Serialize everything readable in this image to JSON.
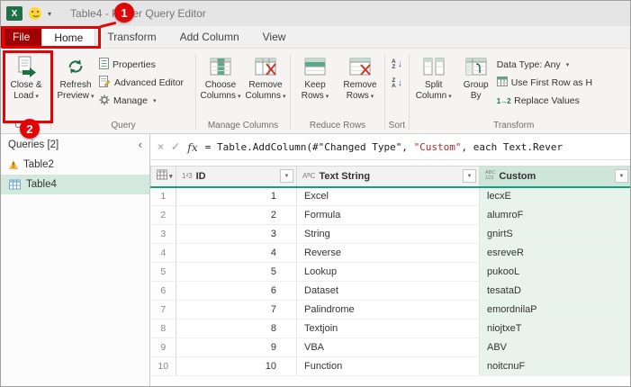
{
  "window": {
    "title": "Table4 - Power Query Editor"
  },
  "annotations": {
    "badge1": "1",
    "badge2": "2"
  },
  "icons": {
    "excel": "X",
    "dropdown_caret": "▾",
    "filter": "▼",
    "collapse": "‹",
    "cancel": "×",
    "commit": "✓",
    "sort_arrow": "↓",
    "replace_values": "1→2"
  },
  "tabs": {
    "file": "File",
    "home": "Home",
    "transform": "Transform",
    "add_column": "Add Column",
    "view": "View"
  },
  "ribbon": {
    "close_load": {
      "line1": "Close &",
      "line2": "Load"
    },
    "close_group_label": "Close",
    "refresh": {
      "line1": "Refresh",
      "line2": "Preview"
    },
    "properties": "Properties",
    "advanced_editor": "Advanced Editor",
    "manage": "Manage",
    "query_group_label": "Query",
    "choose_columns": {
      "line1": "Choose",
      "line2": "Columns"
    },
    "remove_columns": {
      "line1": "Remove",
      "line2": "Columns"
    },
    "manage_columns_group_label": "Manage Columns",
    "keep_rows": {
      "line1": "Keep",
      "line2": "Rows"
    },
    "remove_rows": {
      "line1": "Remove",
      "line2": "Rows"
    },
    "reduce_rows_group_label": "Reduce Rows",
    "sort_az": {
      "top": "A",
      "bottom": "Z"
    },
    "sort_za": {
      "top": "Z",
      "bottom": "A"
    },
    "sort_group_label": "Sort",
    "split_column": {
      "line1": "Split",
      "line2": "Column"
    },
    "group_by": {
      "line1": "Group",
      "line2": "By"
    },
    "data_type_label": "Data Type: Any",
    "use_first_row_label": "Use First Row as H",
    "replace_values_label": "Replace Values",
    "transform_group_label": "Transform"
  },
  "queries_panel": {
    "header": "Queries [2]",
    "items": [
      {
        "name": "Table2",
        "icon": "warning",
        "selected": false
      },
      {
        "name": "Table4",
        "icon": "table",
        "selected": true
      }
    ]
  },
  "formula_bar": {
    "fx_label": "fx",
    "segments": [
      {
        "text": "= Table.AddColumn(#\"Changed Type\", ",
        "color": "#1a1a1a"
      },
      {
        "text": "\"Custom\"",
        "color": "#b02b2b"
      },
      {
        "text": ", each Text.Rever",
        "color": "#1a1a1a"
      }
    ]
  },
  "grid": {
    "columns": [
      {
        "glyph": "1²3",
        "glyph2": null,
        "name": "ID",
        "align": "right",
        "selected": false
      },
      {
        "glyph": "AᴮC",
        "glyph2": null,
        "name": "Text String",
        "align": "left",
        "selected": false
      },
      {
        "glyph": "ABC",
        "glyph2": "123",
        "name": "Custom",
        "align": "left",
        "selected": true
      }
    ],
    "rows": [
      {
        "n": "1",
        "cells": [
          "1",
          "Excel",
          "lecxE"
        ]
      },
      {
        "n": "2",
        "cells": [
          "2",
          "Formula",
          "alumroF"
        ]
      },
      {
        "n": "3",
        "cells": [
          "3",
          "String",
          "gnirtS"
        ]
      },
      {
        "n": "4",
        "cells": [
          "4",
          "Reverse",
          "esreveR"
        ]
      },
      {
        "n": "5",
        "cells": [
          "5",
          "Lookup",
          "pukooL"
        ]
      },
      {
        "n": "6",
        "cells": [
          "6",
          "Dataset",
          "tesataD"
        ]
      },
      {
        "n": "7",
        "cells": [
          "7",
          "Palindrome",
          "emordnilaP"
        ]
      },
      {
        "n": "8",
        "cells": [
          "8",
          "Textjoin",
          "niojtxeT"
        ]
      },
      {
        "n": "9",
        "cells": [
          "9",
          "VBA",
          "ABV"
        ]
      },
      {
        "n": "10",
        "cells": [
          "10",
          "Function",
          "noitcnuF"
        ]
      }
    ]
  }
}
